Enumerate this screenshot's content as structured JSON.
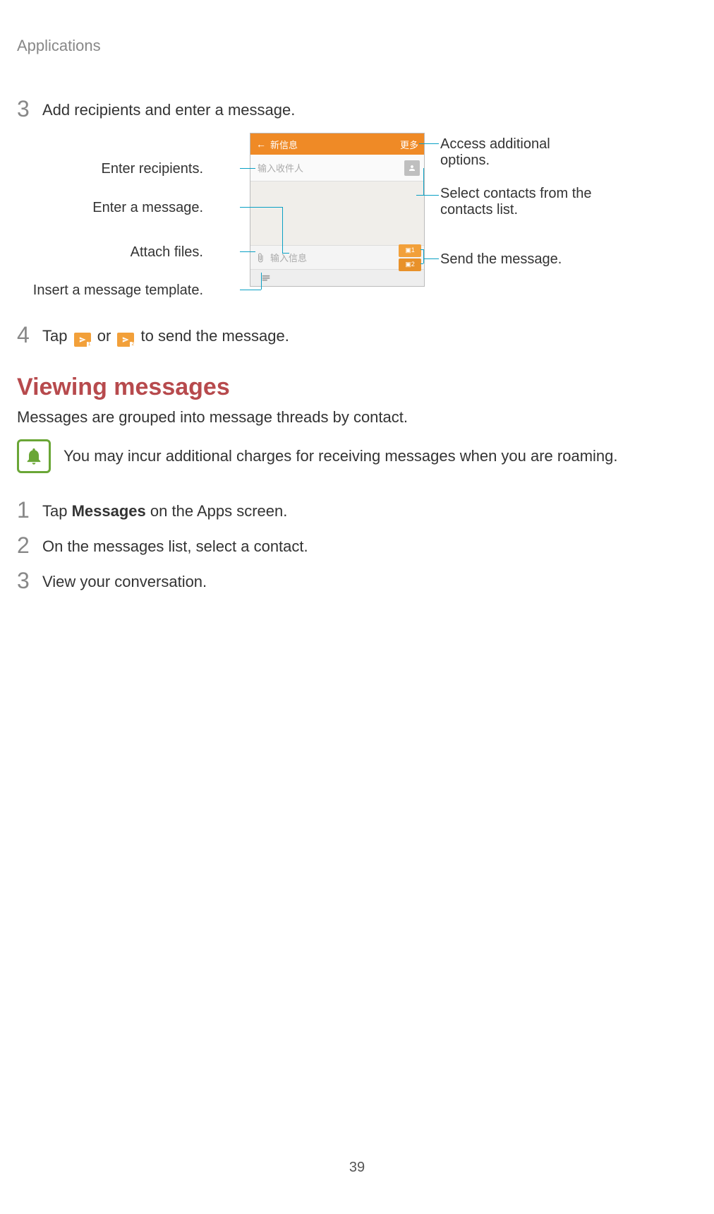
{
  "header": {
    "title": "Applications"
  },
  "steps_a": {
    "s3": {
      "num": "3",
      "text": "Add recipients and enter a message."
    },
    "s4": {
      "num": "4",
      "pre": "Tap ",
      "mid": " or ",
      "post": " to send the message."
    }
  },
  "diagram": {
    "screen": {
      "header_title": "新信息",
      "header_more": "更多",
      "recipient_placeholder": "输入收件人",
      "message_placeholder": "输入信息"
    },
    "labels": {
      "enter_recipients": "Enter recipients.",
      "enter_message": "Enter a message.",
      "attach_files": "Attach files.",
      "insert_template": "Insert a message template.",
      "additional_options": "Access additional options.",
      "select_contacts": "Select contacts from the contacts list.",
      "send_message": "Send the message."
    }
  },
  "section": {
    "title": "Viewing messages"
  },
  "body": {
    "grouped": "Messages are grouped into message threads by contact.",
    "note": "You may incur additional charges for receiving messages when you are roaming."
  },
  "steps_b": {
    "s1": {
      "num": "1",
      "pre": "Tap ",
      "bold": "Messages",
      "post": " on the Apps screen."
    },
    "s2": {
      "num": "2",
      "text": "On the messages list, select a contact."
    },
    "s3": {
      "num": "3",
      "text": "View your conversation."
    }
  },
  "page": {
    "num": "39"
  }
}
